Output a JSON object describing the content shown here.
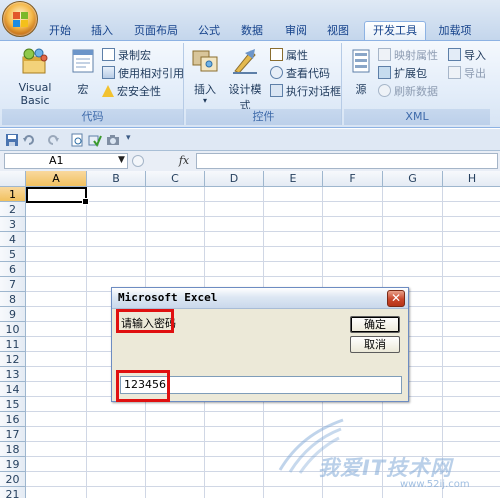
{
  "ribbon": {
    "tabs": [
      "开始",
      "插入",
      "页面布局",
      "公式",
      "数据",
      "审阅",
      "视图",
      "开发工具",
      "加载项"
    ],
    "active_tab": "开发工具",
    "groups": {
      "code": {
        "label": "代码",
        "visual_basic": "Visual Basic",
        "macros": "宏",
        "record_macro": "录制宏",
        "relative_refs": "使用相对引用",
        "macro_security": "宏安全性"
      },
      "controls": {
        "label": "控件",
        "insert": "插入",
        "design_mode": "设计模式",
        "properties": "属性",
        "view_code": "查看代码",
        "run_dialog": "执行对话框"
      },
      "xml": {
        "label": "XML",
        "source": "源",
        "map_properties": "映射属性",
        "expansion_packs": "扩展包",
        "refresh_data": "刷新数据",
        "import": "导入",
        "export": "导出"
      }
    }
  },
  "formula_bar": {
    "name_box": "A1",
    "fx": "fx",
    "formula": ""
  },
  "sheet": {
    "columns": [
      "A",
      "B",
      "C",
      "D",
      "E",
      "F",
      "G",
      "H"
    ],
    "rows": [
      "1",
      "2",
      "3",
      "4",
      "5",
      "6",
      "7",
      "8",
      "9",
      "10",
      "11",
      "12",
      "13",
      "14",
      "15",
      "16",
      "17",
      "18",
      "19",
      "20",
      "21"
    ],
    "active_cell": "A1"
  },
  "dialog": {
    "title": "Microsoft Excel",
    "prompt": "请输入密码",
    "ok": "确定",
    "cancel": "取消",
    "input_value": "123456"
  },
  "watermark": {
    "text": "我爱IT技术网",
    "url": "www.52ij.com"
  },
  "colors": {
    "highlight_box": "#e01010",
    "ribbon_blue": "#15428b"
  }
}
